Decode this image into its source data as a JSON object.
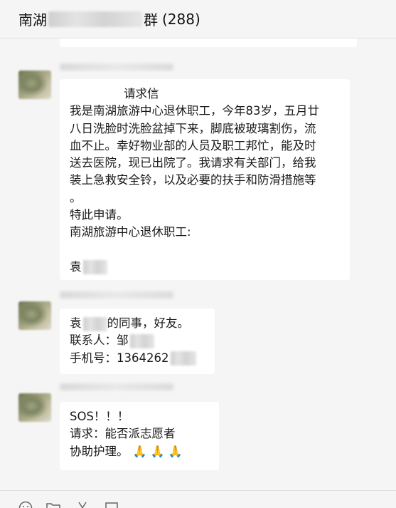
{
  "header": {
    "title_prefix": "南湖",
    "title_suffix": "群",
    "member_count": "(288)"
  },
  "messages": [
    {
      "lines": [
        "请求信",
        "我是南湖旅游中心退休职工，今年83岁，五月廿",
        "八日洗脸时洗脸盆掉下来，脚底被玻璃割伤，流",
        "血不止。幸好物业部的人员及职工邦忙，能及时",
        "送去医院，现已出院了。我请求有关部门，给我",
        "装上急救安全铃，以及必要的扶手和防滑措施等",
        "。",
        "特此申请。",
        "南湖旅游中心退休职工:",
        "",
        "袁"
      ]
    },
    {
      "lines": [
        "袁",
        "的同事，好友。",
        "联系人：邹",
        "手机号：1364262"
      ]
    },
    {
      "lines": [
        "SOS！！！",
        "请求：能否派志愿者",
        "协助护理。"
      ],
      "emoji": "🙏 🙏 🙏"
    }
  ],
  "toolbar": {
    "emoji_icon": "smiley-icon",
    "folder_icon": "folder-icon",
    "scissors_icon": "scissors-icon",
    "chat_icon": "chat-bubble-icon"
  }
}
